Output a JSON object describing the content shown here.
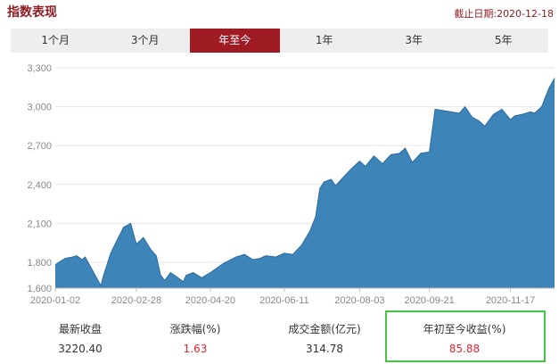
{
  "header": {
    "title": "指数表现",
    "as_of": "截止日期:2020-12-18"
  },
  "tabs": [
    {
      "label": "1个月",
      "active": false
    },
    {
      "label": "3个月",
      "active": false
    },
    {
      "label": "年至今",
      "active": true
    },
    {
      "label": "1年",
      "active": false
    },
    {
      "label": "3年",
      "active": false
    },
    {
      "label": "5年",
      "active": false
    }
  ],
  "chart_data": {
    "type": "area",
    "x_tick_labels": [
      "2020-01-02",
      "2020-02-28",
      "2020-04-20",
      "2020-06-11",
      "2020-08-03",
      "2020-09-21",
      "2020-11-17"
    ],
    "y_tick_labels": [
      "3,300",
      "3,000",
      "2,700",
      "2,400",
      "2,100",
      "1,800",
      "1,600"
    ],
    "ylim": [
      1600,
      3300
    ],
    "grid": true,
    "fill_color": "#3d85b8",
    "line_color": "#2a6aa0",
    "series": [
      {
        "x": [
          "2020-01-02",
          "2020-01-06",
          "2020-01-09",
          "2020-01-14",
          "2020-01-17",
          "2020-01-21",
          "2020-01-23",
          "2020-02-03",
          "2020-02-05",
          "2020-02-10",
          "2020-02-14",
          "2020-02-19",
          "2020-02-24",
          "2020-02-28",
          "2020-03-04",
          "2020-03-09",
          "2020-03-13",
          "2020-03-16",
          "2020-03-19",
          "2020-03-23",
          "2020-03-27",
          "2020-04-01",
          "2020-04-03",
          "2020-04-08",
          "2020-04-14",
          "2020-04-20",
          "2020-04-24",
          "2020-04-29",
          "2020-05-08",
          "2020-05-14",
          "2020-05-20",
          "2020-05-25",
          "2020-05-29",
          "2020-06-05",
          "2020-06-11",
          "2020-06-17",
          "2020-06-23",
          "2020-06-29",
          "2020-07-03",
          "2020-07-06",
          "2020-07-09",
          "2020-07-14",
          "2020-07-17",
          "2020-07-22",
          "2020-07-28",
          "2020-08-03",
          "2020-08-07",
          "2020-08-13",
          "2020-08-19",
          "2020-08-25",
          "2020-08-31",
          "2020-09-04",
          "2020-09-09",
          "2020-09-15",
          "2020-09-21",
          "2020-09-25",
          "2020-10-12",
          "2020-10-16",
          "2020-10-21",
          "2020-10-26",
          "2020-10-30",
          "2020-11-05",
          "2020-11-11",
          "2020-11-17",
          "2020-11-20",
          "2020-11-25",
          "2020-12-01",
          "2020-12-04",
          "2020-12-09",
          "2020-12-14",
          "2020-12-18"
        ],
        "values": [
          1780,
          1810,
          1830,
          1840,
          1850,
          1820,
          1840,
          1620,
          1700,
          1870,
          1960,
          2070,
          2100,
          1940,
          1990,
          1900,
          1850,
          1700,
          1660,
          1720,
          1690,
          1650,
          1700,
          1720,
          1680,
          1720,
          1750,
          1790,
          1840,
          1860,
          1820,
          1830,
          1850,
          1840,
          1870,
          1860,
          1930,
          2040,
          2150,
          2370,
          2420,
          2440,
          2390,
          2450,
          2520,
          2580,
          2540,
          2620,
          2560,
          2630,
          2640,
          2680,
          2570,
          2640,
          2650,
          2980,
          2950,
          3000,
          2920,
          2890,
          2850,
          2940,
          2980,
          2900,
          2930,
          2940,
          2960,
          2950,
          3000,
          3140,
          3220
        ]
      }
    ]
  },
  "stats": [
    {
      "label": "最新收盘",
      "value": "3220.40",
      "color": "#333333"
    },
    {
      "label": "涨跌幅(%)",
      "value": "1.63",
      "color": "#e3262f"
    },
    {
      "label": "成交金额(亿元)",
      "value": "314.78",
      "color": "#333333"
    },
    {
      "label": "年初至今收益(%)",
      "value": "85.88",
      "color": "#e3262f"
    }
  ]
}
